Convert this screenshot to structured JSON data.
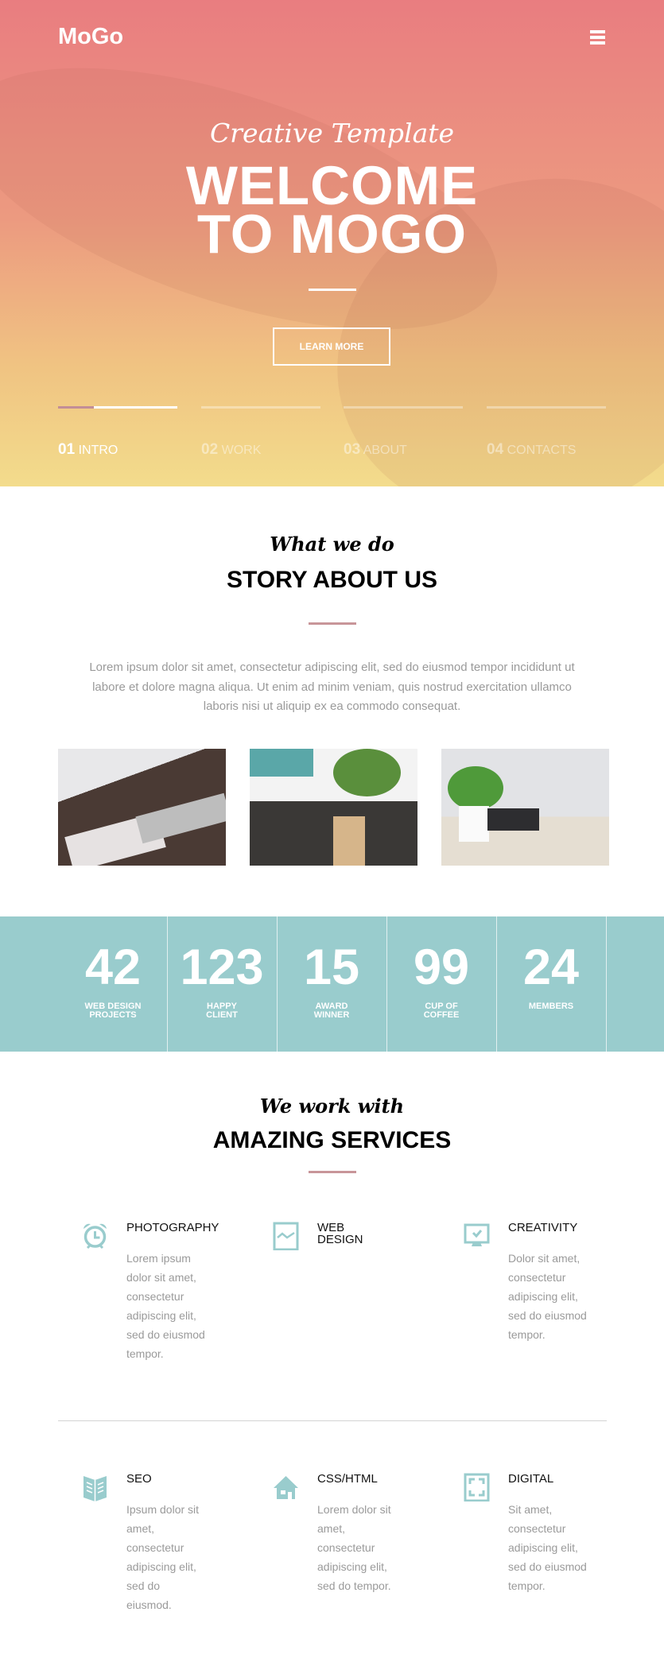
{
  "header": {
    "logo": "MoGo",
    "menu_icon": "hamburger-icon"
  },
  "hero": {
    "subtitle": "Creative Template",
    "title_line1": "WELCOME",
    "title_line2": "TO MOGO",
    "button": "LEARN MORE",
    "slides": [
      {
        "num": "01",
        "label": "INTRO",
        "active": true,
        "progress": 0.3
      },
      {
        "num": "02",
        "label": "WORK"
      },
      {
        "num": "03",
        "label": "ABOUT"
      },
      {
        "num": "04",
        "label": "CONTACTS"
      }
    ]
  },
  "about": {
    "script": "What we do",
    "title": "STORY ABOUT US",
    "text": "Lorem ipsum dolor sit amet, consectetur adipiscing elit, sed do eiusmod tempor incididunt ut labore et dolore magna aliqua. Ut enim ad minim veniam, quis nostrud exercitation ullamco laboris nisi ut aliquip ex ea commodo consequat."
  },
  "stats": [
    {
      "num": "42",
      "label": "WEB DESIGN PROJECTS"
    },
    {
      "num": "123",
      "label": "HAPPY CLIENT"
    },
    {
      "num": "15",
      "label": "AWARD WINNER"
    },
    {
      "num": "99",
      "label": "CUP OF COFFEE"
    },
    {
      "num": "24",
      "label": "MEMBERS"
    }
  ],
  "services": {
    "script": "We work with",
    "title": "AMAZING SERVICES",
    "items": [
      {
        "name": "PHOTOGRAPHY",
        "icon": "alarm-clock-icon",
        "text": "Lorem ipsum dolor sit amet, consectetur adipiscing elit, sed do eiusmod tempor."
      },
      {
        "name": "WEB DESIGN",
        "icon": "chart-line-icon",
        "text": ""
      },
      {
        "name": "CREATIVITY",
        "icon": "monitor-check-icon",
        "text": "Dolor sit amet, consectetur adipiscing elit, sed do eiusmod tempor."
      },
      {
        "name": "SEO",
        "icon": "book-icon",
        "text": "Ipsum dolor sit amet, consectetur adipiscing elit, sed do eiusmod."
      },
      {
        "name": "CSS/HTML",
        "icon": "house-icon",
        "text": "Lorem dolor sit amet, consectetur adipiscing elit, sed do tempor."
      },
      {
        "name": "DIGITAL",
        "icon": "fullscreen-icon",
        "text": "Sit amet, consectetur adipiscing elit, sed do eiusmod tempor."
      }
    ]
  },
  "colors": {
    "accent": "#c89599",
    "teal": "#99cccd",
    "hero_top": "#e97d80",
    "hero_bottom": "#f3dc8c"
  }
}
